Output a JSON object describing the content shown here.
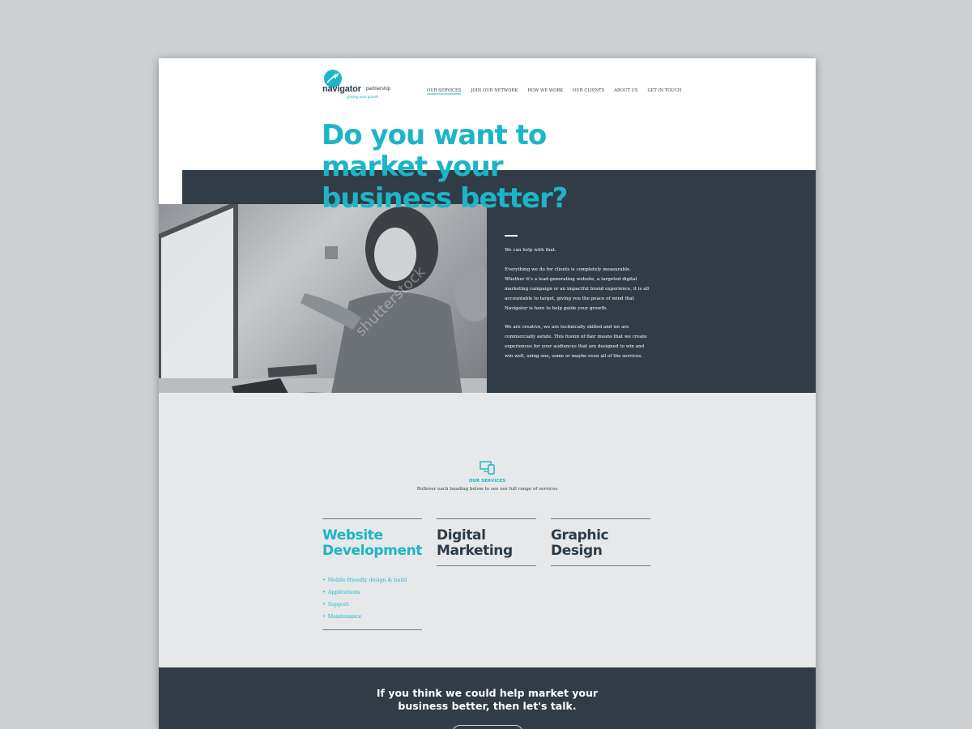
{
  "header": {
    "logo": {
      "name": "navigator",
      "suffix": "partnership",
      "tagline": "guiding your growth"
    },
    "nav": [
      {
        "label": "Our Services",
        "active": true
      },
      {
        "label": "Join Our Network",
        "active": false
      },
      {
        "label": "How We Work",
        "active": false
      },
      {
        "label": "Our Clients",
        "active": false
      },
      {
        "label": "About Us",
        "active": false
      },
      {
        "label": "Get In Touch",
        "active": false
      }
    ]
  },
  "hero": {
    "title": "Do you want to market your business better?",
    "paragraphs": [
      "We can help with that.",
      "Everything we do for clients is completely measurable. Whether it’s a lead-generating website, a targeted digital marketing campaign or an impactful brand experience, it is all accountable to target, giving you the peace of mind that Navigator is here to help guide your growth.",
      "We are creative, we are technically skilled and we are commercially astute. This fusion of flair means that we create experiences for your audiences that are designed to win and win well, using one, some or maybe even all of the services."
    ],
    "photo_watermark": "shutterstock"
  },
  "services": {
    "label": "Our Services",
    "subtitle": "Rollover each heading below to see our full range of services",
    "columns": [
      {
        "title_line1": "Website",
        "title_line2": "Development",
        "active": true,
        "items": [
          "Mobile friendly design & build",
          "Applications",
          "Support",
          "Maintenance"
        ]
      },
      {
        "title_line1": "Digital",
        "title_line2": "Marketing",
        "active": false,
        "items": []
      },
      {
        "title_line1": "Graphic",
        "title_line2": "Design",
        "active": false,
        "items": []
      }
    ]
  },
  "cta": {
    "line1": "If you think we could help market your",
    "line2": "business better, then let's talk."
  },
  "colors": {
    "accent": "#1cb5c7",
    "dark": "#313c47",
    "light_bg": "#e6e8e9",
    "frame_bg": "#cdd0d3"
  }
}
